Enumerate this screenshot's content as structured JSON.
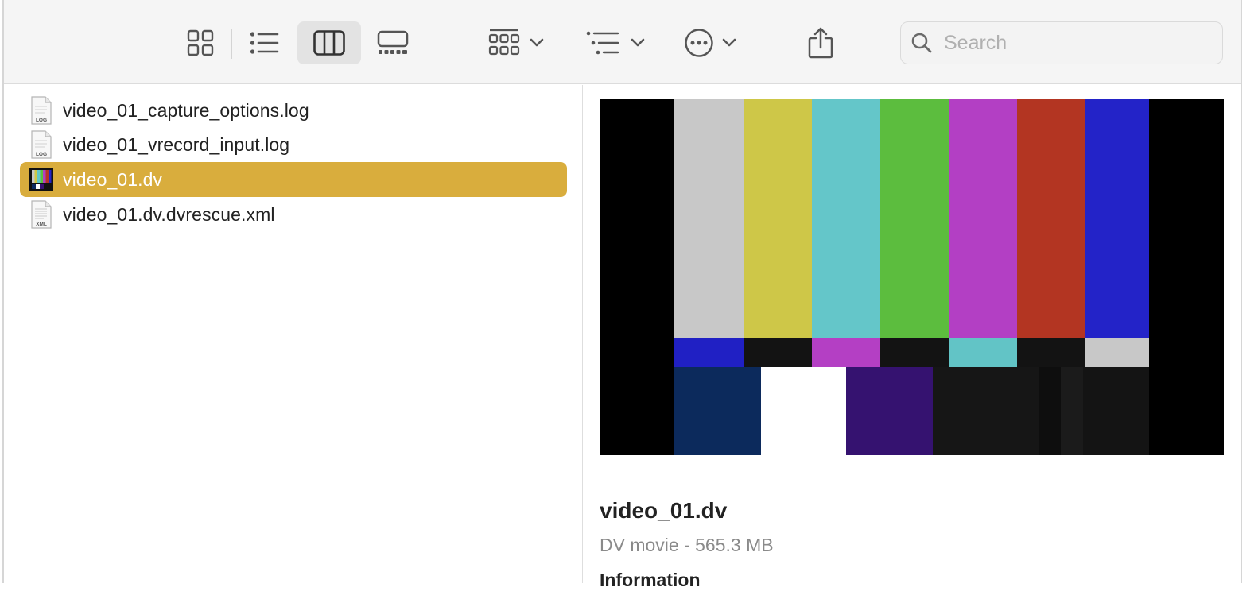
{
  "toolbar": {
    "view_buttons": [
      {
        "name": "icon-view",
        "active": false
      },
      {
        "name": "list-view",
        "active": false
      },
      {
        "name": "column-view",
        "active": true
      },
      {
        "name": "gallery-view",
        "active": false
      }
    ],
    "search_placeholder": "Search",
    "search_value": ""
  },
  "files": [
    {
      "name": "video_01_capture_options.log",
      "icon": "log-file-icon",
      "icon_label": "LOG",
      "selected": false
    },
    {
      "name": "video_01_vrecord_input.log",
      "icon": "log-file-icon",
      "icon_label": "LOG",
      "selected": false
    },
    {
      "name": "video_01.dv",
      "icon": "video-thumbnail-icon",
      "icon_label": "",
      "selected": true
    },
    {
      "name": "video_01.dv.dvrescue.xml",
      "icon": "xml-file-icon",
      "icon_label": "XML",
      "selected": false
    }
  ],
  "preview": {
    "title": "video_01.dv",
    "subtitle": "DV movie - 565.3 MB",
    "section": "Information"
  },
  "colors": {
    "selection": "#d9ad3d",
    "toolbar_bg": "#f5f5f5"
  }
}
